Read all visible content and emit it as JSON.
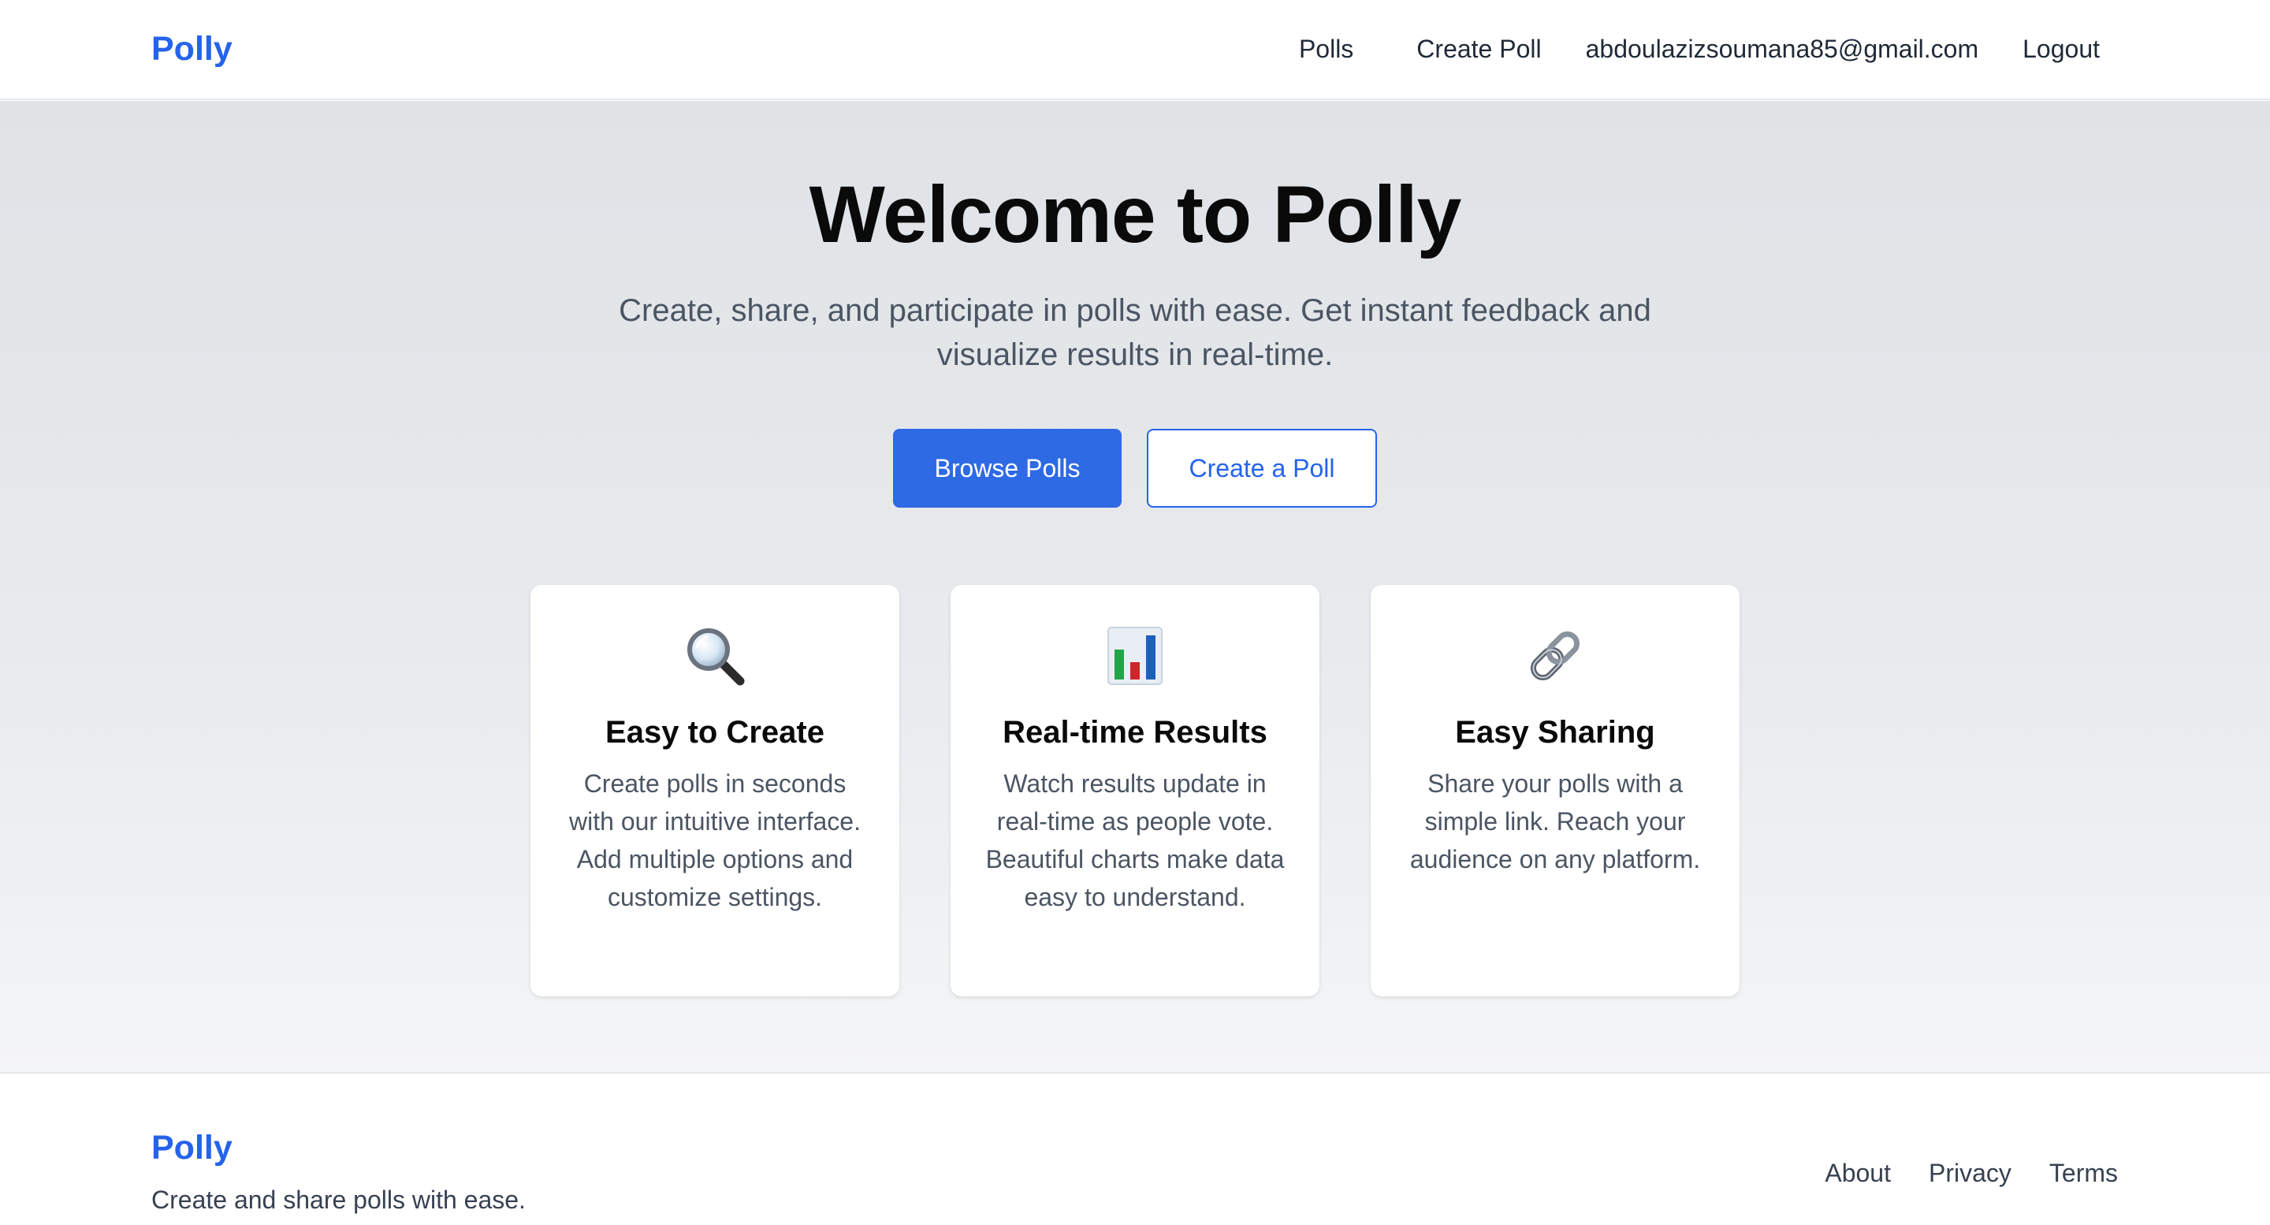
{
  "header": {
    "brand": "Polly",
    "nav": {
      "polls": "Polls",
      "create_poll": "Create Poll",
      "user_email": "abdoulazizsoumana85@gmail.com",
      "logout": "Logout"
    }
  },
  "hero": {
    "title": "Welcome to Polly",
    "subtitle": "Create, share, and participate in polls with ease. Get instant feedback and visualize results in real-time.",
    "primary_button": "Browse Polls",
    "secondary_button": "Create a Poll"
  },
  "features": [
    {
      "icon": "magnifying-glass-icon",
      "title": "Easy to Create",
      "text": "Create polls in seconds with our intuitive interface. Add multiple options and customize settings."
    },
    {
      "icon": "bar-chart-icon",
      "title": "Real-time Results",
      "text": "Watch results update in real-time as people vote. Beautiful charts make data easy to understand."
    },
    {
      "icon": "link-icon",
      "title": "Easy Sharing",
      "text": "Share your polls with a simple link. Reach your audience on any platform."
    }
  ],
  "footer": {
    "brand": "Polly",
    "tagline": "Create and share polls with ease.",
    "links": [
      "About",
      "Privacy",
      "Terms"
    ]
  },
  "colors": {
    "accent": "#2563eb",
    "primary_button": "#2f6ae5"
  }
}
